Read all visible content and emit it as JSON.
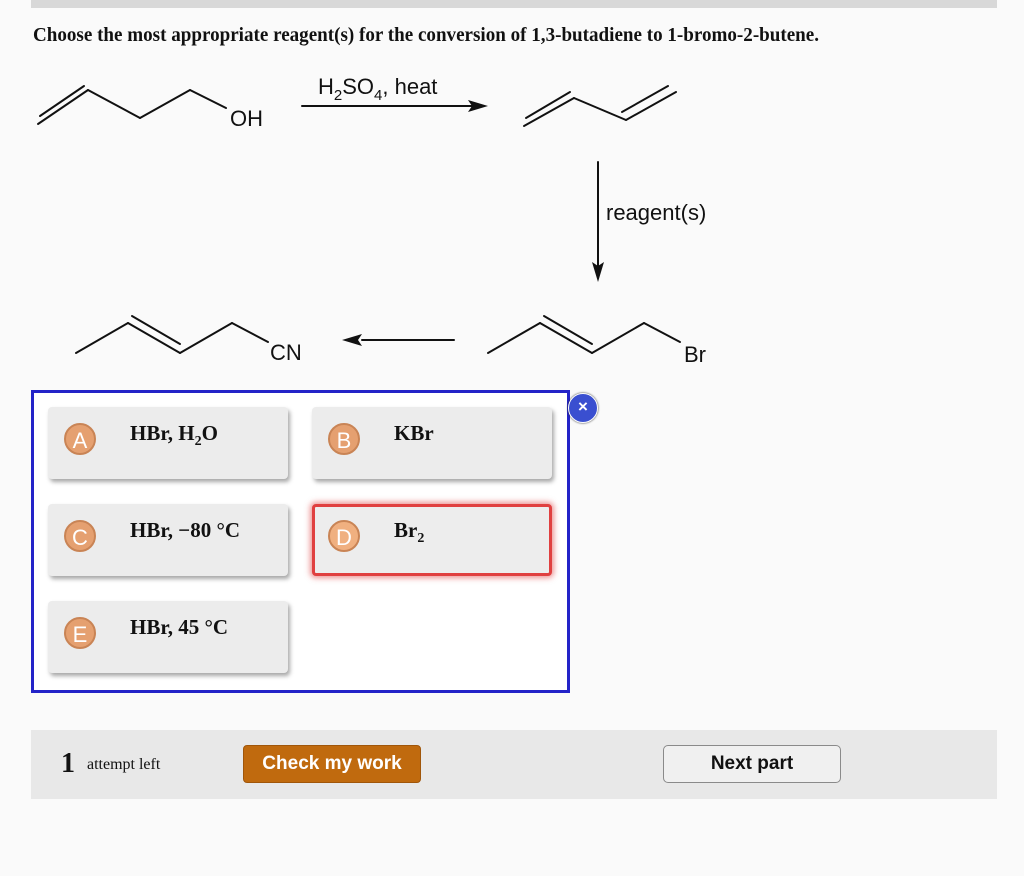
{
  "question": "Choose the most appropriate reagent(s) for the conversion of 1,3-butadiene to 1-bromo-2-butene.",
  "scheme": {
    "oh_label": "OH",
    "reagent1_main": "H",
    "reagent1_sub1": "2",
    "reagent1_mid": "SO",
    "reagent1_sub2": "4",
    "reagent1_tail": ", heat",
    "reagent2": "reagent(s)",
    "cn_label": "CN",
    "br_label": "Br"
  },
  "choices": [
    {
      "letter": "A",
      "text_main": "HBr, H",
      "text_sub": "2",
      "text_tail": "O"
    },
    {
      "letter": "B",
      "text_main": "KBr"
    },
    {
      "letter": "C",
      "text_main": "HBr, −80 °C"
    },
    {
      "letter": "D",
      "text_main": "Br",
      "text_sub": "2",
      "selected": true
    },
    {
      "letter": "E",
      "text_main": "HBr, 45 °C"
    }
  ],
  "close_icon": "×",
  "footer": {
    "attempts_count": "1",
    "attempts_label": "attempt left",
    "check_button": "Check my work",
    "next_button": "Next part"
  },
  "colors": {
    "selection_border": "#2323c8",
    "selected_choice": "#e04040",
    "letter_badge": "#e5a070",
    "check_button": "#c06a0e"
  }
}
